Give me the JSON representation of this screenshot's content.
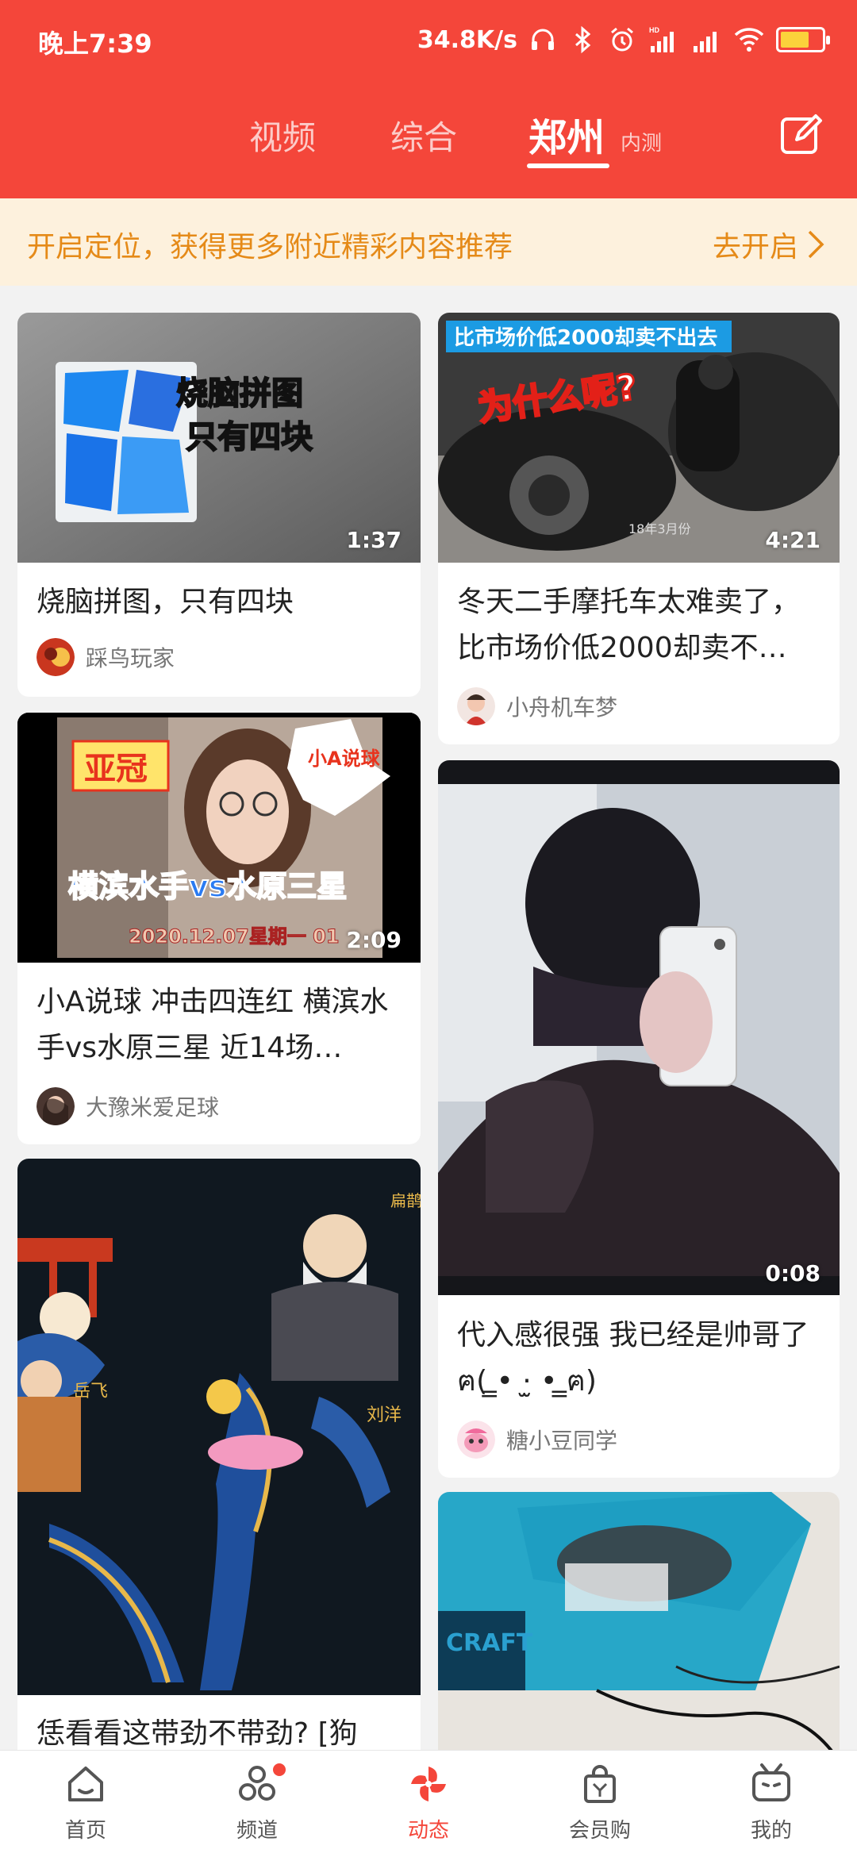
{
  "status_bar": {
    "time": "晚上7:39",
    "net_speed": "34.8K/s",
    "battery_level": 0.7,
    "hd_label": "HD"
  },
  "header": {
    "tabs": [
      {
        "label": "视频",
        "active": false
      },
      {
        "label": "综合",
        "active": false
      },
      {
        "label": "郑州",
        "active": true
      }
    ],
    "beta_badge": "内测",
    "edit_icon": "edit-icon",
    "accent_color": "#f4463a"
  },
  "location_banner": {
    "message": "开启定位，获得更多附近精彩内容推荐",
    "action": "去开启",
    "color": "#e58a18"
  },
  "feed": {
    "cards": [
      {
        "title": "烧脑拼图，只有四块",
        "author": "踩鸟玩家",
        "duration": "1:37",
        "overlay_text": [
          "烧脑拼图",
          "只有四块"
        ]
      },
      {
        "title": "冬天二手摩托车太难卖了，比市场价低2000却卖不…",
        "author": "小舟机车梦",
        "duration": "4:21",
        "overlay_text": [
          "比市场价低2000却卖不出去",
          "为什么呢?",
          "18年3月份"
        ]
      },
      {
        "title": "小A说球 冲击四连红 横滨水手vs水原三星 近14场…",
        "author": "大豫米爱足球",
        "duration": "2:09",
        "overlay_text": [
          "亚冠",
          "小A说球",
          "横滨水手vs水原三星",
          "2020.12.07星期一 01"
        ]
      },
      {
        "title": "代入感很强 我已经是帅哥了ฅ( ̳• ·̫ • ̳ฅ)",
        "author": "糖小豆同学",
        "duration": "0:08"
      },
      {
        "title": "恁看看这带劲不带劲? [狗",
        "overlay_text": [
          "岳飞",
          "刘洋",
          "扁鹊"
        ]
      },
      {
        "overlay_text": [
          "CRAFT"
        ]
      }
    ]
  },
  "bottom_nav": {
    "items": [
      {
        "label": "首页",
        "icon": "home-icon",
        "active": false
      },
      {
        "label": "频道",
        "icon": "channel-icon",
        "active": false,
        "badge": true
      },
      {
        "label": "动态",
        "icon": "dynamic-pinwheel-icon",
        "active": true
      },
      {
        "label": "会员购",
        "icon": "shopping-bag-icon",
        "active": false
      },
      {
        "label": "我的",
        "icon": "tv-mascot-icon",
        "active": false
      }
    ]
  }
}
